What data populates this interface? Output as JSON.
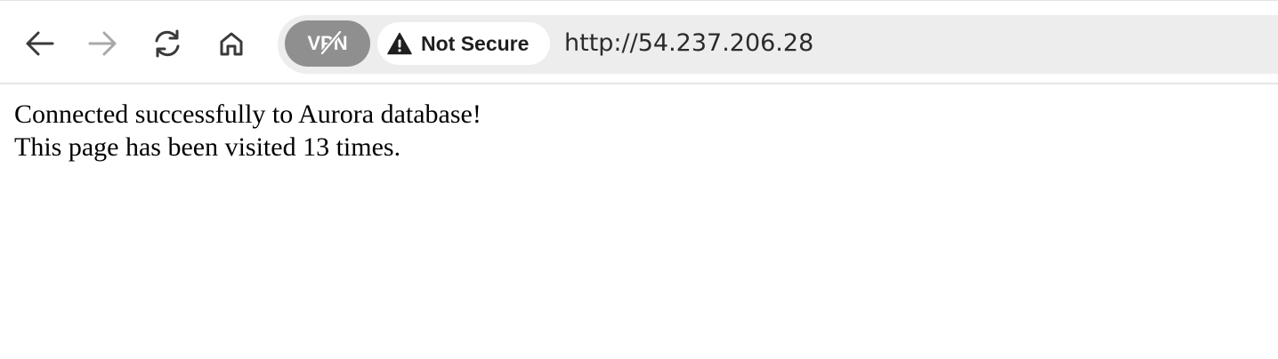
{
  "toolbar": {
    "back_icon": "arrow-left-icon",
    "forward_icon": "arrow-right-icon",
    "reload_icon": "reload-icon",
    "home_icon": "home-icon"
  },
  "address_bar": {
    "vpn_label": "VPN",
    "vpn_state": "disabled",
    "security_icon": "warning-triangle-icon",
    "security_label": "Not Secure",
    "url": "http://54.237.206.28"
  },
  "page": {
    "line1": "Connected successfully to Aurora database!",
    "line2": "This page has been visited 13 times."
  },
  "colors": {
    "vpn_pill": "#8f8f8f",
    "address_bar_bg": "#eeeded",
    "forward_disabled": "#a8a8a8",
    "icon_active": "#3a3a3a"
  }
}
